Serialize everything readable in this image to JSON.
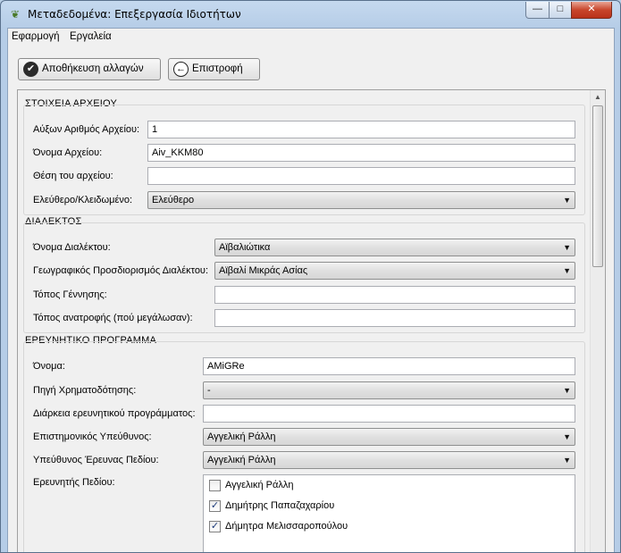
{
  "window": {
    "title": "Μεταδεδομένα: Επεξεργασία Ιδιοτήτων",
    "controls": {
      "minimize": "—",
      "maximize": "□",
      "close": "✕"
    }
  },
  "menu": [
    "Εφαρμογή",
    "Εργαλεία"
  ],
  "toolbar": {
    "save_label": "Αποθήκευση αλλαγών",
    "back_label": "Επιστροφή"
  },
  "file_section": {
    "title": "ΣΤΟΙΧΕΙΑ ΑΡΧΕΙΟΥ",
    "serial_label": "Αύξων Αριθμός Αρχείου:",
    "serial_value": "1",
    "name_label": "Όνομα Αρχείου:",
    "name_value": "Aiv_KKM80",
    "location_label": "Θέση του αρχείου:",
    "location_value": "",
    "lock_label": "Ελεύθερο/Κλειδωμένο:",
    "lock_value": "Ελεύθερο"
  },
  "dialect_section": {
    "title": "ΔΙΑΛΕΚΤΟΣ",
    "name_label": "Όνομα Διαλέκτου:",
    "name_value": "Αϊβαλιώτικα",
    "geo_label": "Γεωγραφικός Προσδιορισμός Διαλέκτου:",
    "geo_value": "Αϊβαλί Μικράς Ασίας",
    "birthplace_label": "Τόπος Γέννησης:",
    "birthplace_value": "",
    "upbringing_label": "Τόπος ανατροφής (πού μεγάλωσαν):",
    "upbringing_value": ""
  },
  "program_section": {
    "title": "ΕΡΕΥΝΗΤΙΚΟ ΠΡΟΓΡΑΜΜΑ",
    "name_label": "Όνομα:",
    "name_value": "AMiGRe",
    "funding_label": "Πηγή Χρηματοδότησης:",
    "funding_value": "-",
    "duration_label": "Διάρκεια ερευνητικού προγράμματος:",
    "duration_value": "",
    "scientific_label": "Επιστημονικός Υπεύθυνος:",
    "scientific_value": "Αγγελική Ράλλη",
    "field_lead_label": "Υπεύθυνος Έρευνας Πεδίου:",
    "field_lead_value": "Αγγελική Ράλλη",
    "researcher_label": "Ερευνητής Πεδίου:",
    "researchers": [
      {
        "name": "Αγγελική Ράλλη",
        "checked": false
      },
      {
        "name": "Δημήτρης Παπαζαχαρίου",
        "checked": true
      },
      {
        "name": "Δήμητρα Μελισσαροπούλου",
        "checked": true
      }
    ]
  }
}
